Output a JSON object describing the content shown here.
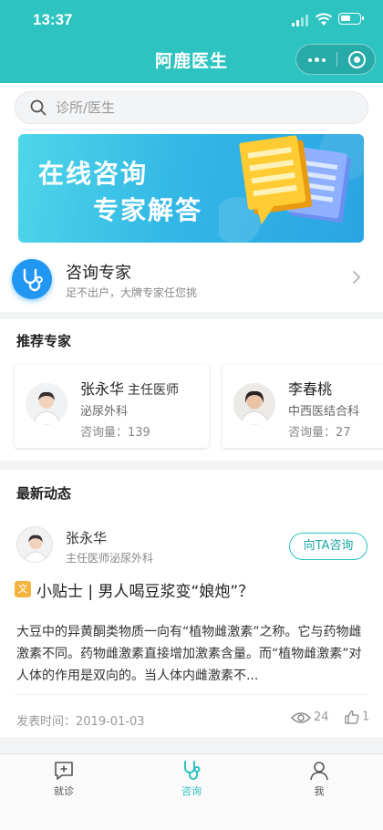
{
  "status_bar": {
    "time": "13:37"
  },
  "nav": {
    "title": "阿鹿医生"
  },
  "search": {
    "placeholder": "诊所/医生"
  },
  "banner": {
    "line1": "在线咨询",
    "line2": "专家解答"
  },
  "consult": {
    "title": "咨询专家",
    "subtitle": "足不出户，大牌专家任您挑"
  },
  "experts_section": {
    "title": "推荐专家",
    "cards": [
      {
        "name": "张永华",
        "title": "主任医师",
        "dept": "泌尿外科",
        "count_label": "咨询量：139"
      },
      {
        "name": "李春桃",
        "title": "",
        "dept": "中西医结合科",
        "count_label": "咨询量：27"
      }
    ]
  },
  "news_section": {
    "title": "最新动态",
    "author": "张永华",
    "author_title": "主任医师泌尿外科",
    "consult_button": "向TA咨询",
    "tag": "文",
    "post_title": "小贴士 | 男人喝豆浆变“娘炮”？",
    "body": "大豆中的异黄酮类物质一向有“植物雌激素”之称。它与药物雌激素不同。药物雌激素直接增加激素含量。而“植物雌激素”对人体的作用是双向的。当人体内雌激素不...",
    "date": "发表时间：2019-01-03",
    "views": "24",
    "likes": "1"
  },
  "tabbar": {
    "items": [
      {
        "label": "就诊",
        "icon": "plus-chat-icon"
      },
      {
        "label": "咨询",
        "icon": "stethoscope-icon"
      },
      {
        "label": "我",
        "icon": "user-icon"
      }
    ],
    "active": "咨询"
  },
  "colors": {
    "brand": "#2cc3c0",
    "accent_blue": "#2196f3",
    "tag": "#f4b23e"
  }
}
